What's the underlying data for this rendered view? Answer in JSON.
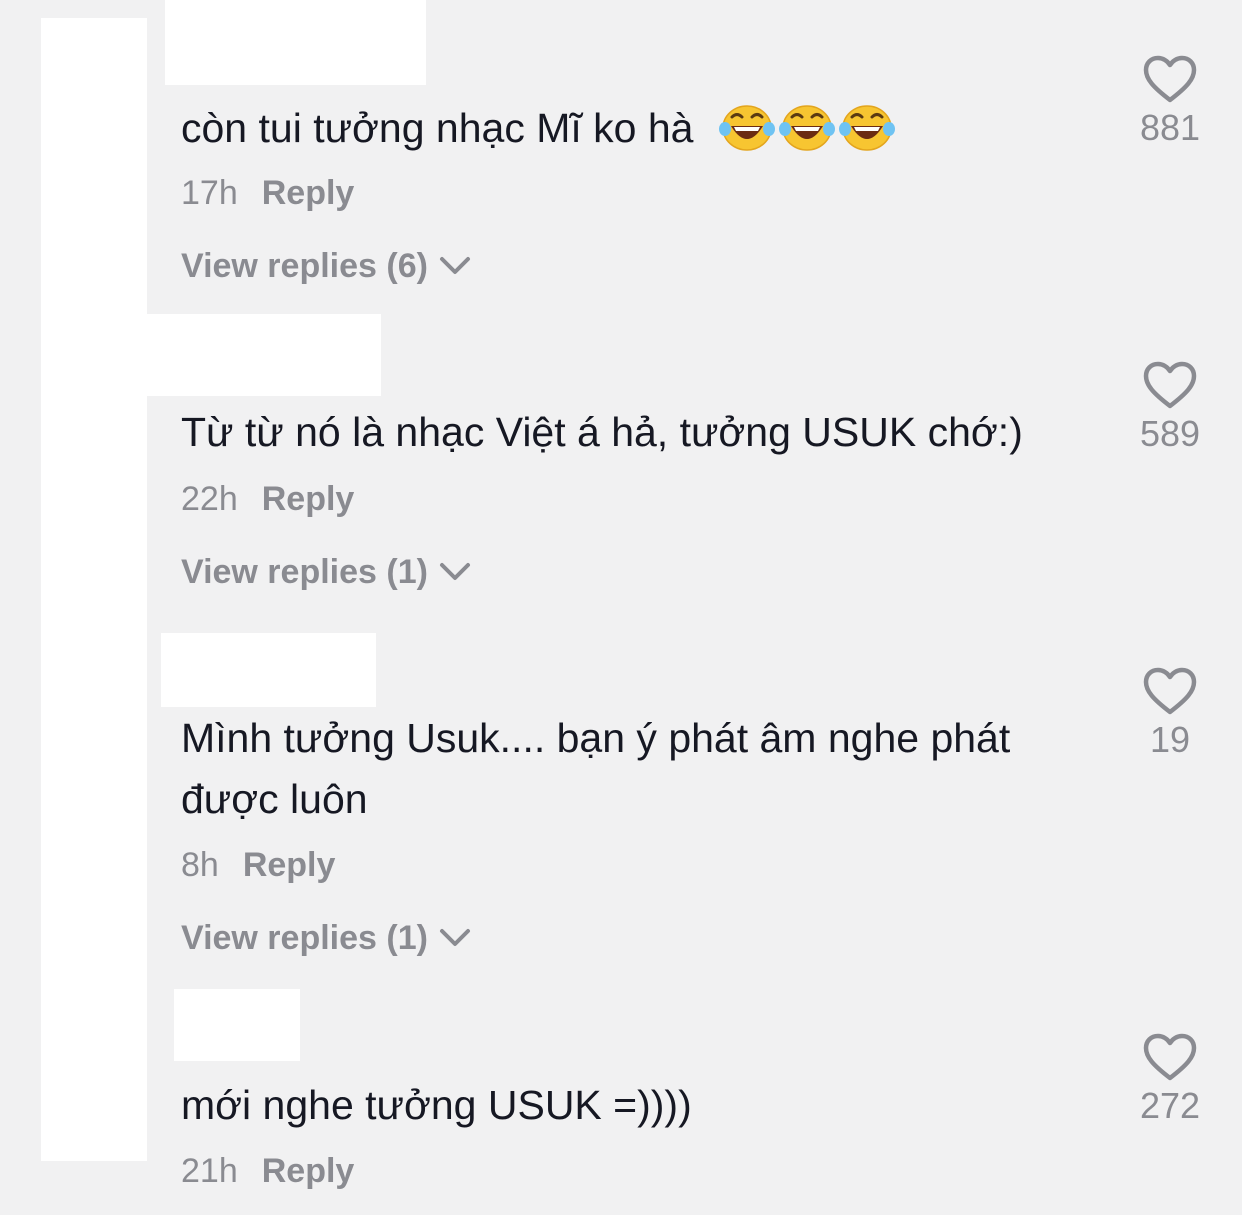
{
  "comments": [
    {
      "text": "còn tui tưởng nhạc Mĩ ko hà",
      "emoji": [
        "face-with-tears-of-joy",
        "face-with-tears-of-joy",
        "face-with-tears-of-joy"
      ],
      "time": "17h",
      "reply_label": "Reply",
      "view_replies": "View replies (6)",
      "likes": "881"
    },
    {
      "text": "Từ từ nó là nhạc Việt á hả, tưởng USUK chớ:)",
      "time": "22h",
      "reply_label": "Reply",
      "view_replies": "View replies (1)",
      "likes": "589"
    },
    {
      "text": "Mình tưởng Usuk.... bạn ý phát âm nghe phát được luôn",
      "time": "8h",
      "reply_label": "Reply",
      "view_replies": "View replies (1)",
      "likes": "19"
    },
    {
      "text": "mới nghe tưởng USUK =))))",
      "time": "21h",
      "reply_label": "Reply",
      "likes": "272"
    }
  ],
  "icons": {
    "like": "heart-outline-icon",
    "expand": "chevron-down-icon"
  },
  "colors": {
    "background": "#f1f1f2",
    "text_primary": "#161823",
    "text_secondary": "#8a8b91",
    "redaction": "#ffffff"
  }
}
